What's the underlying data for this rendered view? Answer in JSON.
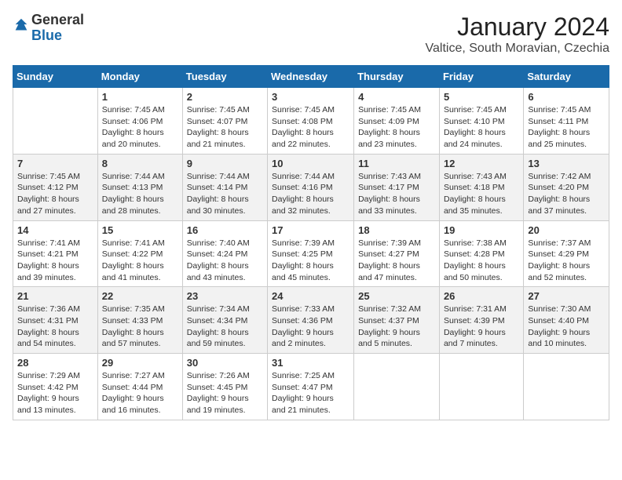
{
  "header": {
    "logo_general": "General",
    "logo_blue": "Blue",
    "month_year": "January 2024",
    "location": "Valtice, South Moravian, Czechia"
  },
  "weekdays": [
    "Sunday",
    "Monday",
    "Tuesday",
    "Wednesday",
    "Thursday",
    "Friday",
    "Saturday"
  ],
  "weeks": [
    [
      {
        "day": "",
        "detail": ""
      },
      {
        "day": "1",
        "detail": "Sunrise: 7:45 AM\nSunset: 4:06 PM\nDaylight: 8 hours\nand 20 minutes."
      },
      {
        "day": "2",
        "detail": "Sunrise: 7:45 AM\nSunset: 4:07 PM\nDaylight: 8 hours\nand 21 minutes."
      },
      {
        "day": "3",
        "detail": "Sunrise: 7:45 AM\nSunset: 4:08 PM\nDaylight: 8 hours\nand 22 minutes."
      },
      {
        "day": "4",
        "detail": "Sunrise: 7:45 AM\nSunset: 4:09 PM\nDaylight: 8 hours\nand 23 minutes."
      },
      {
        "day": "5",
        "detail": "Sunrise: 7:45 AM\nSunset: 4:10 PM\nDaylight: 8 hours\nand 24 minutes."
      },
      {
        "day": "6",
        "detail": "Sunrise: 7:45 AM\nSunset: 4:11 PM\nDaylight: 8 hours\nand 25 minutes."
      }
    ],
    [
      {
        "day": "7",
        "detail": "Sunrise: 7:45 AM\nSunset: 4:12 PM\nDaylight: 8 hours\nand 27 minutes."
      },
      {
        "day": "8",
        "detail": "Sunrise: 7:44 AM\nSunset: 4:13 PM\nDaylight: 8 hours\nand 28 minutes."
      },
      {
        "day": "9",
        "detail": "Sunrise: 7:44 AM\nSunset: 4:14 PM\nDaylight: 8 hours\nand 30 minutes."
      },
      {
        "day": "10",
        "detail": "Sunrise: 7:44 AM\nSunset: 4:16 PM\nDaylight: 8 hours\nand 32 minutes."
      },
      {
        "day": "11",
        "detail": "Sunrise: 7:43 AM\nSunset: 4:17 PM\nDaylight: 8 hours\nand 33 minutes."
      },
      {
        "day": "12",
        "detail": "Sunrise: 7:43 AM\nSunset: 4:18 PM\nDaylight: 8 hours\nand 35 minutes."
      },
      {
        "day": "13",
        "detail": "Sunrise: 7:42 AM\nSunset: 4:20 PM\nDaylight: 8 hours\nand 37 minutes."
      }
    ],
    [
      {
        "day": "14",
        "detail": "Sunrise: 7:41 AM\nSunset: 4:21 PM\nDaylight: 8 hours\nand 39 minutes."
      },
      {
        "day": "15",
        "detail": "Sunrise: 7:41 AM\nSunset: 4:22 PM\nDaylight: 8 hours\nand 41 minutes."
      },
      {
        "day": "16",
        "detail": "Sunrise: 7:40 AM\nSunset: 4:24 PM\nDaylight: 8 hours\nand 43 minutes."
      },
      {
        "day": "17",
        "detail": "Sunrise: 7:39 AM\nSunset: 4:25 PM\nDaylight: 8 hours\nand 45 minutes."
      },
      {
        "day": "18",
        "detail": "Sunrise: 7:39 AM\nSunset: 4:27 PM\nDaylight: 8 hours\nand 47 minutes."
      },
      {
        "day": "19",
        "detail": "Sunrise: 7:38 AM\nSunset: 4:28 PM\nDaylight: 8 hours\nand 50 minutes."
      },
      {
        "day": "20",
        "detail": "Sunrise: 7:37 AM\nSunset: 4:29 PM\nDaylight: 8 hours\nand 52 minutes."
      }
    ],
    [
      {
        "day": "21",
        "detail": "Sunrise: 7:36 AM\nSunset: 4:31 PM\nDaylight: 8 hours\nand 54 minutes."
      },
      {
        "day": "22",
        "detail": "Sunrise: 7:35 AM\nSunset: 4:33 PM\nDaylight: 8 hours\nand 57 minutes."
      },
      {
        "day": "23",
        "detail": "Sunrise: 7:34 AM\nSunset: 4:34 PM\nDaylight: 8 hours\nand 59 minutes."
      },
      {
        "day": "24",
        "detail": "Sunrise: 7:33 AM\nSunset: 4:36 PM\nDaylight: 9 hours\nand 2 minutes."
      },
      {
        "day": "25",
        "detail": "Sunrise: 7:32 AM\nSunset: 4:37 PM\nDaylight: 9 hours\nand 5 minutes."
      },
      {
        "day": "26",
        "detail": "Sunrise: 7:31 AM\nSunset: 4:39 PM\nDaylight: 9 hours\nand 7 minutes."
      },
      {
        "day": "27",
        "detail": "Sunrise: 7:30 AM\nSunset: 4:40 PM\nDaylight: 9 hours\nand 10 minutes."
      }
    ],
    [
      {
        "day": "28",
        "detail": "Sunrise: 7:29 AM\nSunset: 4:42 PM\nDaylight: 9 hours\nand 13 minutes."
      },
      {
        "day": "29",
        "detail": "Sunrise: 7:27 AM\nSunset: 4:44 PM\nDaylight: 9 hours\nand 16 minutes."
      },
      {
        "day": "30",
        "detail": "Sunrise: 7:26 AM\nSunset: 4:45 PM\nDaylight: 9 hours\nand 19 minutes."
      },
      {
        "day": "31",
        "detail": "Sunrise: 7:25 AM\nSunset: 4:47 PM\nDaylight: 9 hours\nand 21 minutes."
      },
      {
        "day": "",
        "detail": ""
      },
      {
        "day": "",
        "detail": ""
      },
      {
        "day": "",
        "detail": ""
      }
    ]
  ]
}
